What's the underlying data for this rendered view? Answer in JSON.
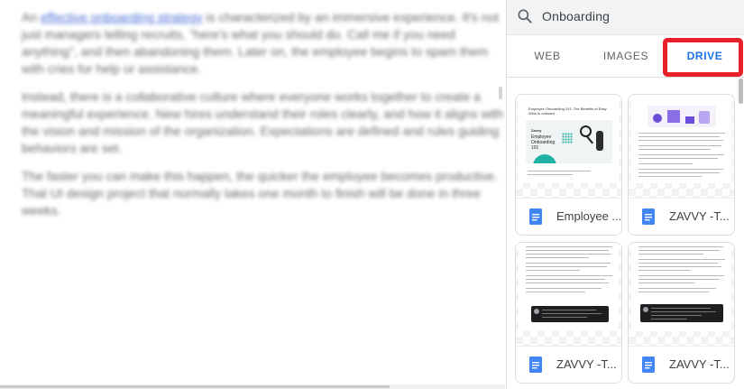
{
  "document": {
    "para1_link": "effective onboarding strategy",
    "para1_prefix": "An ",
    "para1_rest": " is characterized by an immersive experience. It's not just managers telling recruits, \"here's what you should do. Call me if you need anything\", and then abandoning them. Later on, the employee begins to spam them with cries for help or assistance.",
    "para2": "Instead, there is a collaborative culture where everyone works together to create a meaningful experience. New hires understand their roles clearly, and how it aligns with the vision and mission of the organization. Expectations are defined and rules guiding behaviors are set.",
    "para3": "The faster you can make this happen, the quicker the employee becomes productive. That UI design project that normally takes one month to finish will be done in three weeks."
  },
  "search": {
    "query": "Onboarding",
    "icon": "search-icon"
  },
  "tabs": [
    {
      "label": "WEB"
    },
    {
      "label": "IMAGES"
    },
    {
      "label": "DRIVE",
      "active": true
    }
  ],
  "colors": {
    "accent": "#1a73e8",
    "highlight": "#e8202a",
    "doc_icon": "#4285f4"
  },
  "results": [
    {
      "title": "Employee ...",
      "thumb_title": "Employee Onboarding 101: The Benefits of Easy Wins in onboard",
      "thumb_logo": "Zavvy",
      "thumb_heading": "Employee Onboarding 101"
    },
    {
      "title": "ZAVVY -T..."
    },
    {
      "title": "ZAVVY -T..."
    },
    {
      "title": "ZAVVY -T..."
    }
  ]
}
